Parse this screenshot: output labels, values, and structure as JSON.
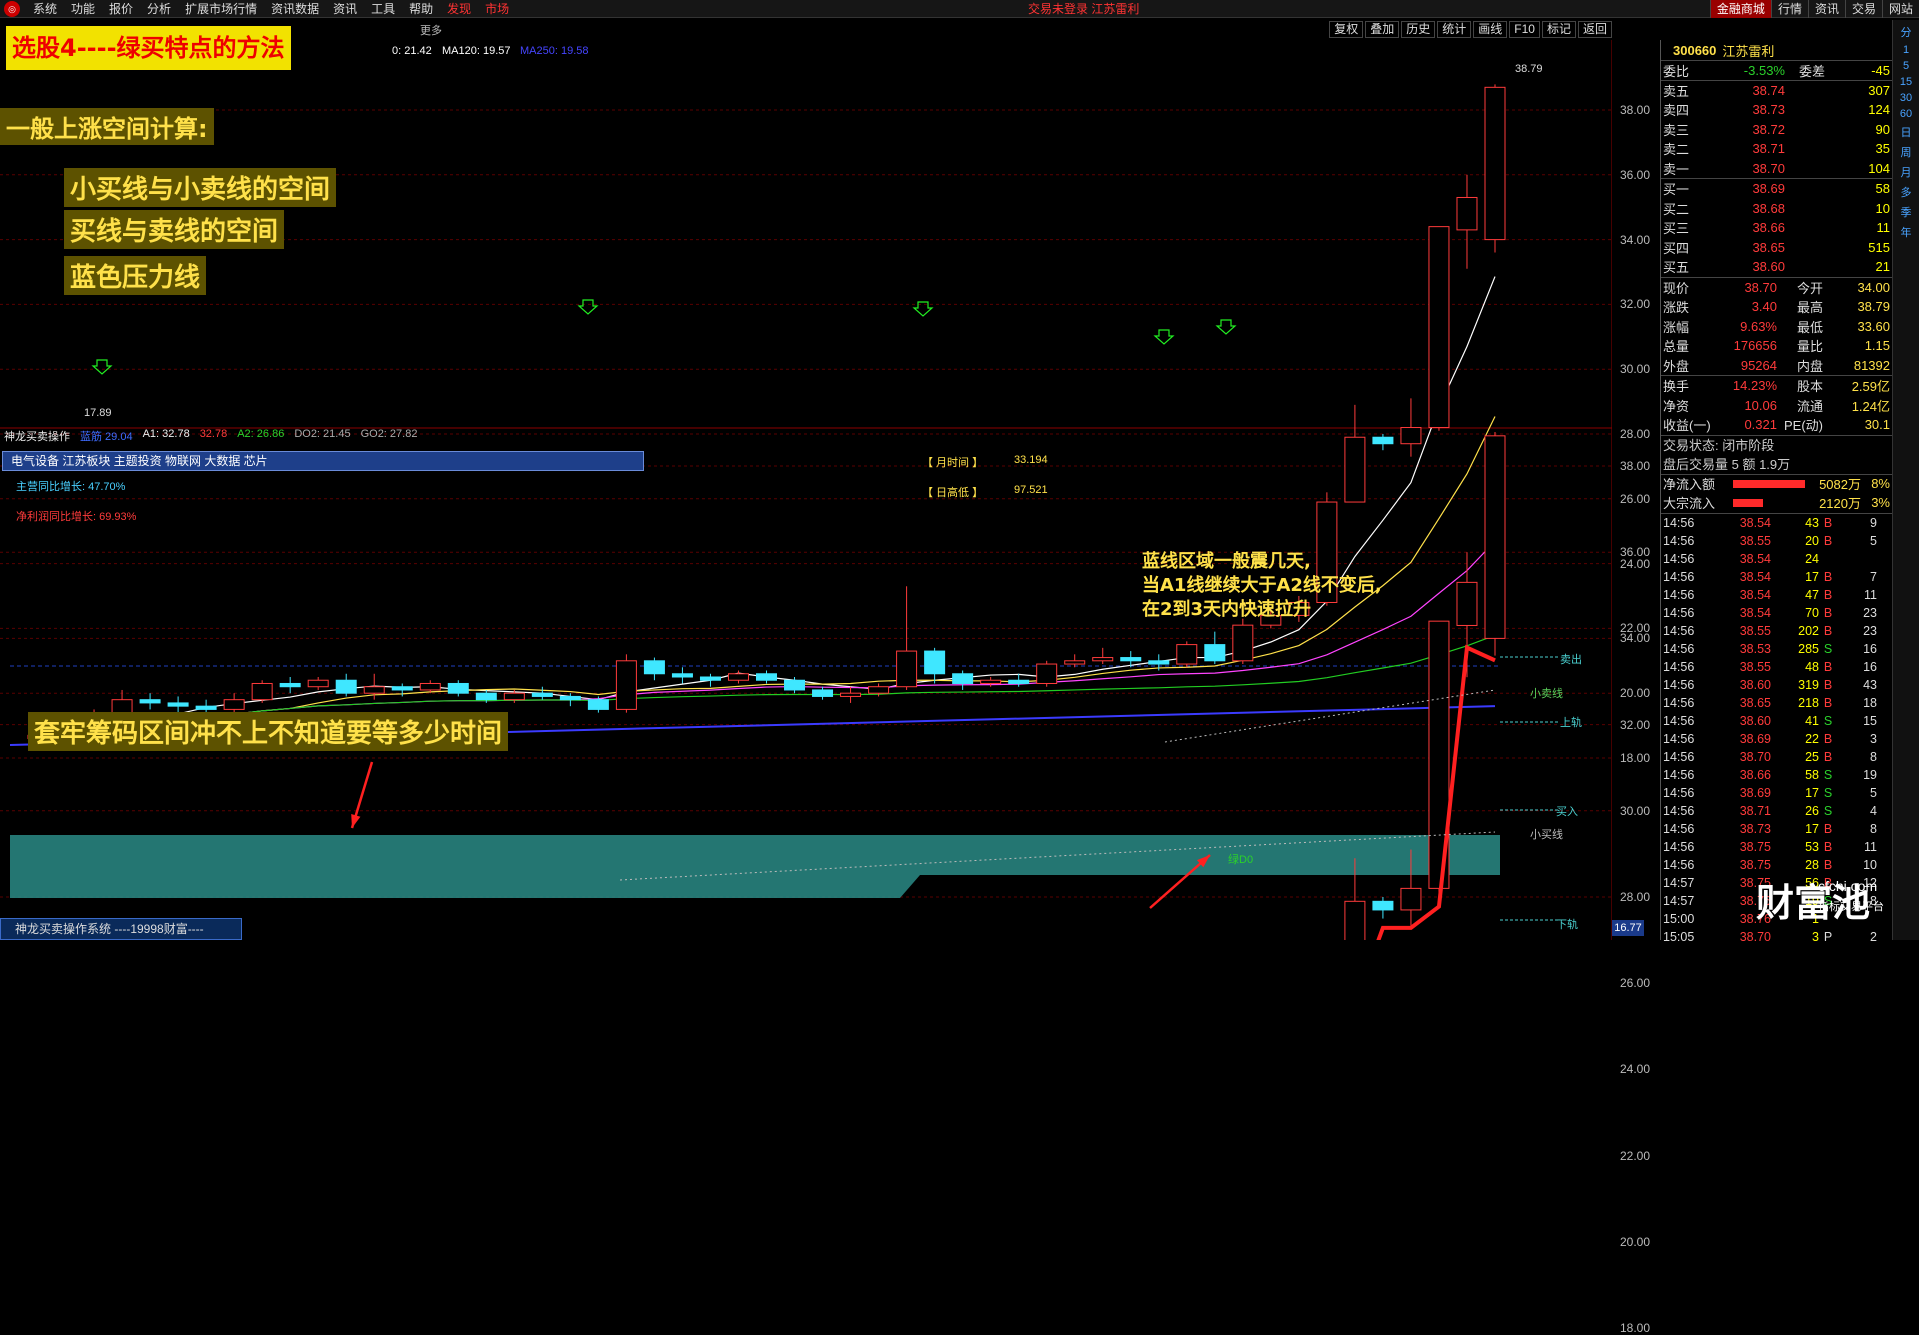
{
  "menu": {
    "items": [
      "系统",
      "功能",
      "报价",
      "分析",
      "扩展市场行情",
      "资讯数据",
      "资讯",
      "工具",
      "帮助"
    ],
    "discover": "发现",
    "market": "市场",
    "login_status": "交易未登录 江苏雷利",
    "right": [
      "金融商城",
      "行情",
      "资讯",
      "交易",
      "网站"
    ]
  },
  "toolbar": {
    "tabs": [
      "复权",
      "叠加",
      "历史",
      "统计",
      "画线",
      "F10",
      "标记",
      "返回"
    ],
    "more": "更多",
    "ma_text_a": "0: 21.42",
    "ma_text_b": "MA120: 19.57",
    "ma_text_c": "MA250: 19.58"
  },
  "main_chart": {
    "yticks": [
      "38.00",
      "36.00",
      "34.00",
      "32.00",
      "30.00",
      "28.00",
      "26.00",
      "24.00",
      "22.00",
      "20.00",
      "18.00"
    ],
    "high_label": "38.79",
    "low_label": "17.89"
  },
  "indicator": {
    "name": "神龙买卖操作",
    "blue": "蓝筋 29.04",
    "a1": "A1: 32.78",
    "a1b": "32.78",
    "a2": "A2: 26.86",
    "do2": "DO2: 21.45",
    "go2": "GO2: 27.82",
    "yticks": [
      "38.00",
      "36.00",
      "34.00",
      "32.00",
      "30.00",
      "28.00",
      "26.00",
      "24.00",
      "22.00",
      "20.00",
      "18.00"
    ],
    "lines": {
      "sell": "卖出",
      "small_sell": "小卖线",
      "upper": "上轨",
      "buy": "买入",
      "small_buy": "小买线",
      "lower": "下轨",
      "green": "绿D0"
    },
    "month_time_label": "【 月时间 】",
    "month_time_value": "33.194",
    "day_high_label": "【 日高低 】",
    "day_high_value": "97.521",
    "bottom_value": "16.77"
  },
  "info": {
    "sector": "电气设备 江苏板块 主题投资 物联网 大数据 芯片",
    "main_growth": "主营同比增长: 47.70%",
    "profit_growth": "净利润同比增长: 69.93%"
  },
  "overlays": {
    "title": "选股4----绿买特点的方法",
    "a1": "一般上涨空间计算:",
    "a2": "小买线与小卖线的空间",
    "a3": "买线与卖线的空间",
    "a4": "蓝色压力线",
    "a5": "套牢筹码区间冲不上不知道要等多少时间",
    "a6_lines": [
      "蓝线区域一般震几天,",
      "当A1线继续大于A2线不变后,",
      "在2到3天内快速拉升"
    ]
  },
  "sidebar": {
    "code": "300660",
    "name": "江苏雷利",
    "ratio_label": "委比",
    "ratio": "-3.53%",
    "diff_label": "委差",
    "diff": "-45",
    "asks": [
      [
        "卖五",
        "38.74",
        "307"
      ],
      [
        "卖四",
        "38.73",
        "124"
      ],
      [
        "卖三",
        "38.72",
        "90"
      ],
      [
        "卖二",
        "38.71",
        "35"
      ],
      [
        "卖一",
        "38.70",
        "104"
      ]
    ],
    "bids": [
      [
        "买一",
        "38.69",
        "58"
      ],
      [
        "买二",
        "38.68",
        "10"
      ],
      [
        "买三",
        "38.66",
        "11"
      ],
      [
        "买四",
        "38.65",
        "515"
      ],
      [
        "买五",
        "38.60",
        "21"
      ]
    ],
    "stats": [
      [
        "现价",
        "38.70",
        "今开",
        "34.00"
      ],
      [
        "涨跌",
        "3.40",
        "最高",
        "38.79"
      ],
      [
        "涨幅",
        "9.63%",
        "最低",
        "33.60"
      ],
      [
        "总量",
        "176656",
        "量比",
        "1.15"
      ],
      [
        "外盘",
        "95264",
        "内盘",
        "81392"
      ]
    ],
    "stats2": [
      [
        "换手",
        "14.23%",
        "股本",
        "2.59亿"
      ],
      [
        "净资",
        "10.06",
        "流通",
        "1.24亿"
      ],
      [
        "收益(一)",
        "0.321",
        "PE(动)",
        "30.1"
      ]
    ],
    "trade_status": "交易状态: 闭市阶段",
    "after": "盘后交易量 5 额 1.9万",
    "inflow_label": "净流入额",
    "inflow": "5082万",
    "inflow_pct": "8%",
    "block_label": "大宗流入",
    "block": "2120万",
    "block_pct": "3%",
    "ticks": [
      [
        "14:56",
        "38.54",
        "43",
        "B",
        "9"
      ],
      [
        "14:56",
        "38.55",
        "20",
        "B",
        "5"
      ],
      [
        "14:56",
        "38.54",
        "24",
        "",
        ""
      ],
      [
        "14:56",
        "38.54",
        "17",
        "B",
        "7"
      ],
      [
        "14:56",
        "38.54",
        "47",
        "B",
        "11"
      ],
      [
        "14:56",
        "38.54",
        "70",
        "B",
        "23"
      ],
      [
        "14:56",
        "38.55",
        "202",
        "B",
        "23"
      ],
      [
        "14:56",
        "38.53",
        "285",
        "S",
        "16"
      ],
      [
        "14:56",
        "38.55",
        "48",
        "B",
        "16"
      ],
      [
        "14:56",
        "38.60",
        "319",
        "B",
        "43"
      ],
      [
        "14:56",
        "38.65",
        "218",
        "B",
        "18"
      ],
      [
        "14:56",
        "38.60",
        "41",
        "S",
        "15"
      ],
      [
        "14:56",
        "38.69",
        "22",
        "B",
        "3"
      ],
      [
        "14:56",
        "38.70",
        "25",
        "B",
        "8"
      ],
      [
        "14:56",
        "38.66",
        "58",
        "S",
        "19"
      ],
      [
        "14:56",
        "38.69",
        "17",
        "S",
        "5"
      ],
      [
        "14:56",
        "38.71",
        "26",
        "S",
        "4"
      ],
      [
        "14:56",
        "38.73",
        "17",
        "B",
        "8"
      ],
      [
        "14:56",
        "38.75",
        "53",
        "B",
        "11"
      ],
      [
        "14:56",
        "38.75",
        "28",
        "B",
        "10"
      ],
      [
        "14:57",
        "38.75",
        "56",
        "B",
        "12"
      ],
      [
        "14:57",
        "38.76",
        "19",
        "S",
        "8"
      ],
      [
        "15:00",
        "38.76",
        "1",
        "",
        ""
      ],
      [
        "15:05",
        "38.70",
        "3",
        "P",
        "2"
      ]
    ]
  },
  "bottom": {
    "title": "神龙买卖操作系统 ----19998财富----"
  },
  "watermark": {
    "main": "财富池",
    "site": "cfchi.com",
    "sub": "指标交易平台"
  },
  "rstrip": [
    "分",
    "1",
    "5",
    "15",
    "30",
    "60",
    "日",
    "周",
    "月",
    "多",
    "季",
    "年"
  ],
  "chart_data": {
    "type": "candlestick",
    "ylim": [
      17.5,
      39
    ],
    "candles": [
      [
        18.6,
        18.7,
        18.4,
        18.9
      ],
      [
        18.7,
        18.5,
        18.3,
        18.8
      ],
      [
        18.5,
        19.2,
        18.4,
        19.5
      ],
      [
        19.3,
        19.8,
        19.0,
        20.1
      ],
      [
        19.8,
        19.7,
        19.5,
        20.0
      ],
      [
        19.7,
        19.6,
        19.4,
        19.9
      ],
      [
        19.6,
        19.5,
        19.3,
        19.8
      ],
      [
        19.5,
        19.8,
        19.4,
        20.0
      ],
      [
        19.8,
        20.3,
        19.7,
        20.4
      ],
      [
        20.3,
        20.2,
        20.0,
        20.5
      ],
      [
        20.2,
        20.4,
        20.1,
        20.5
      ],
      [
        20.4,
        20.0,
        19.9,
        20.6
      ],
      [
        20.0,
        20.2,
        19.8,
        20.6
      ],
      [
        20.2,
        20.1,
        19.9,
        20.3
      ],
      [
        20.1,
        20.3,
        20.0,
        20.4
      ],
      [
        20.3,
        20.0,
        19.9,
        20.4
      ],
      [
        20.0,
        19.8,
        19.7,
        20.1
      ],
      [
        19.8,
        20.0,
        19.7,
        20.1
      ],
      [
        20.0,
        19.9,
        19.8,
        20.2
      ],
      [
        19.9,
        19.8,
        19.6,
        20.0
      ],
      [
        19.8,
        19.5,
        19.4,
        19.9
      ],
      [
        19.5,
        21.0,
        19.4,
        21.2
      ],
      [
        21.0,
        20.6,
        20.4,
        21.1
      ],
      [
        20.6,
        20.5,
        20.3,
        20.8
      ],
      [
        20.5,
        20.4,
        20.2,
        20.6
      ],
      [
        20.4,
        20.6,
        20.3,
        20.7
      ],
      [
        20.6,
        20.4,
        20.3,
        20.7
      ],
      [
        20.4,
        20.1,
        20.0,
        20.5
      ],
      [
        20.1,
        19.9,
        19.8,
        20.2
      ],
      [
        19.9,
        20.0,
        19.7,
        20.2
      ],
      [
        20.0,
        20.2,
        19.9,
        20.3
      ],
      [
        20.2,
        21.3,
        20.1,
        23.3
      ],
      [
        21.3,
        20.6,
        20.3,
        21.4
      ],
      [
        20.6,
        20.3,
        20.1,
        20.7
      ],
      [
        20.3,
        20.4,
        20.2,
        20.5
      ],
      [
        20.4,
        20.3,
        20.2,
        20.6
      ],
      [
        20.3,
        20.9,
        20.2,
        21.0
      ],
      [
        20.9,
        21.0,
        20.8,
        21.2
      ],
      [
        21.0,
        21.1,
        20.9,
        21.4
      ],
      [
        21.1,
        21.0,
        20.8,
        21.3
      ],
      [
        21.0,
        20.9,
        20.7,
        21.2
      ],
      [
        20.9,
        21.5,
        20.8,
        21.6
      ],
      [
        21.5,
        21.0,
        20.9,
        21.9
      ],
      [
        21.0,
        22.1,
        20.9,
        22.3
      ],
      [
        22.1,
        22.4,
        22.0,
        22.6
      ],
      [
        22.4,
        22.8,
        22.2,
        23.0
      ],
      [
        22.8,
        25.9,
        22.7,
        26.2
      ],
      [
        25.9,
        27.9,
        25.9,
        28.9
      ],
      [
        27.9,
        27.7,
        27.5,
        28.0
      ],
      [
        27.7,
        28.2,
        27.3,
        29.1
      ],
      [
        28.2,
        34.4,
        28.1,
        34.4
      ],
      [
        34.3,
        35.3,
        33.1,
        36.0
      ],
      [
        34.0,
        38.7,
        33.6,
        38.79
      ]
    ]
  }
}
